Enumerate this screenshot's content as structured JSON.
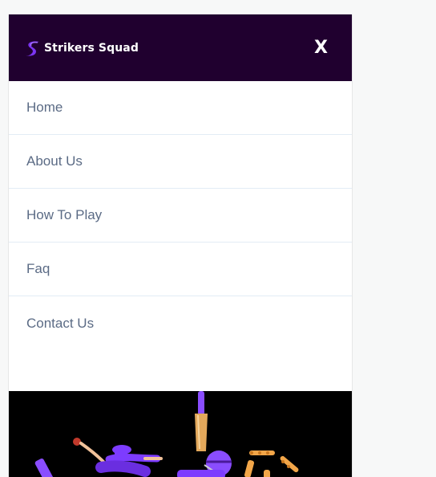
{
  "header": {
    "logo_text": "Strikers Squad",
    "close_label": "X",
    "background": "#20002f"
  },
  "menu": {
    "items": [
      {
        "label": "Home"
      },
      {
        "label": "About Us"
      },
      {
        "label": "How To Play"
      },
      {
        "label": "Faq"
      },
      {
        "label": "Contact Us"
      }
    ]
  },
  "banner": {
    "image": "cricket-players-illustration",
    "accent": "#7d3cff"
  }
}
